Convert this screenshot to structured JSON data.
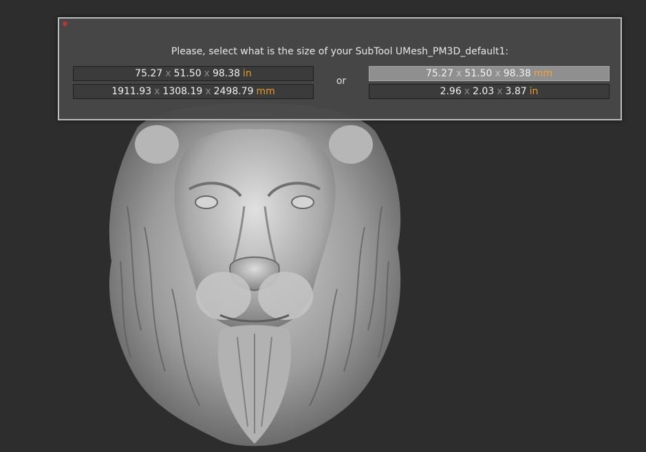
{
  "dialog": {
    "prompt": "Please, select what is the size of your SubTool UMesh_PM3D_default1:",
    "or_label": "or",
    "separator": "x",
    "options": {
      "left_top": {
        "w": "75.27",
        "h": "51.50",
        "d": "98.38",
        "unit": "in"
      },
      "left_bot": {
        "w": "1911.93",
        "h": "1308.19",
        "d": "2498.79",
        "unit": "mm"
      },
      "right_top": {
        "w": "75.27",
        "h": "51.50",
        "d": "98.38",
        "unit": "mm"
      },
      "right_bot": {
        "w": "2.96",
        "h": "2.03",
        "d": "3.87",
        "unit": "in"
      }
    }
  },
  "colors": {
    "background": "#2d2d2d",
    "unit_accent": "#e89a2c",
    "close_dot": "#b03a3a"
  },
  "icons": {
    "close": "close-dot-icon"
  },
  "viewport": {
    "subject": "lion-head-sculpt"
  }
}
